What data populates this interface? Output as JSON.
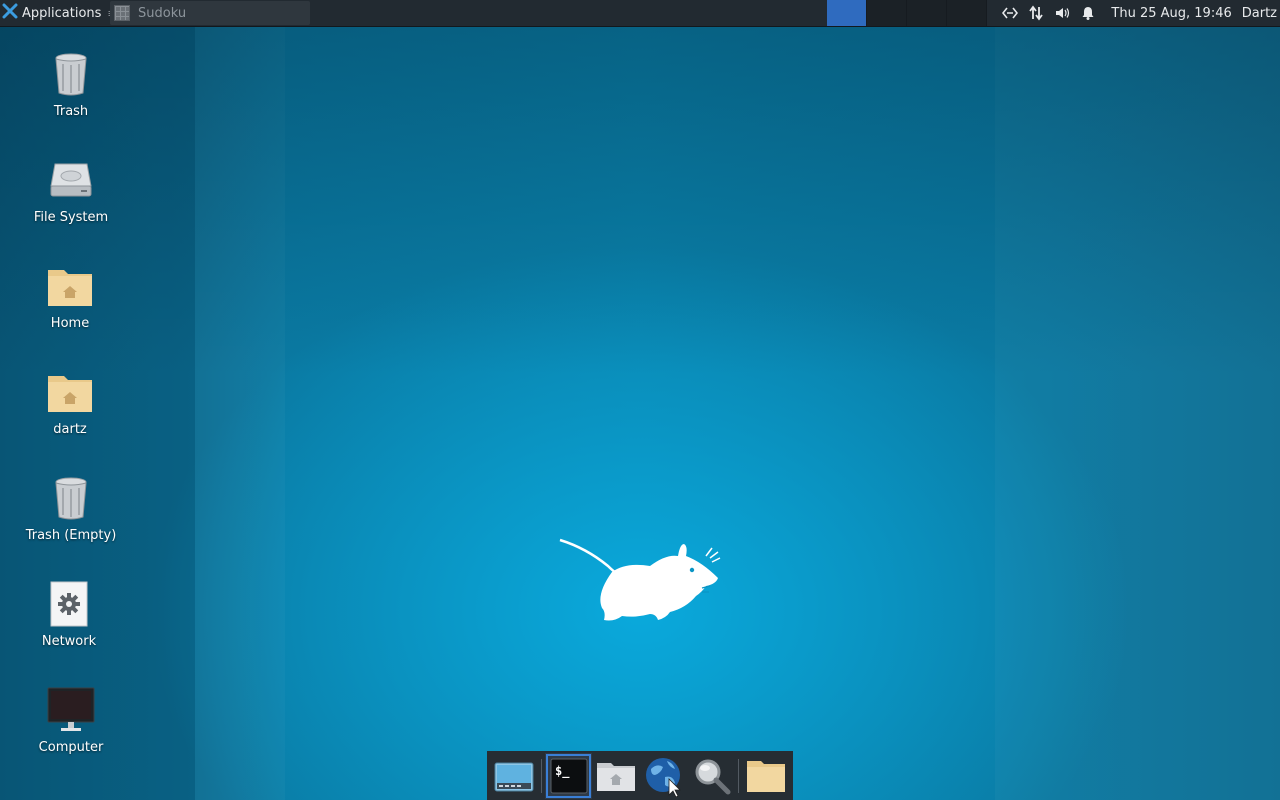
{
  "top_panel": {
    "applications_label": "Applications",
    "applications_separator": "≡",
    "task_title": "Sudoku",
    "clock": "Thu 25 Aug, 19:46",
    "user": "Dartz",
    "workspaces": 4,
    "active_workspace": 1
  },
  "desktop": {
    "icons": [
      {
        "label": "Trash",
        "icon": "trash-icon"
      },
      {
        "label": "File System",
        "icon": "harddisk-icon"
      },
      {
        "label": "Home",
        "icon": "home-folder-icon"
      },
      {
        "label": "dartz",
        "icon": "home-folder-icon"
      },
      {
        "label": "Trash (Empty)",
        "icon": "trash-icon"
      },
      {
        "label": "Network",
        "icon": "network-settings-icon"
      },
      {
        "label": "Computer",
        "icon": "monitor-icon"
      }
    ]
  },
  "dock": {
    "items": [
      {
        "name": "show-desktop",
        "icon": "desktop-icon"
      },
      {
        "name": "terminal",
        "icon": "terminal-icon",
        "active": true
      },
      {
        "name": "file-manager",
        "icon": "home-folder-icon"
      },
      {
        "name": "web-browser",
        "icon": "globe-icon"
      },
      {
        "name": "app-finder",
        "icon": "magnifier-icon"
      },
      {
        "name": "folder",
        "icon": "folder-icon"
      }
    ]
  },
  "colors": {
    "panel_bg": "#222a31",
    "desktop_bg": "#0a82ac",
    "workspace_active": "#2f6bbf",
    "folder": "#f2d7a0"
  }
}
